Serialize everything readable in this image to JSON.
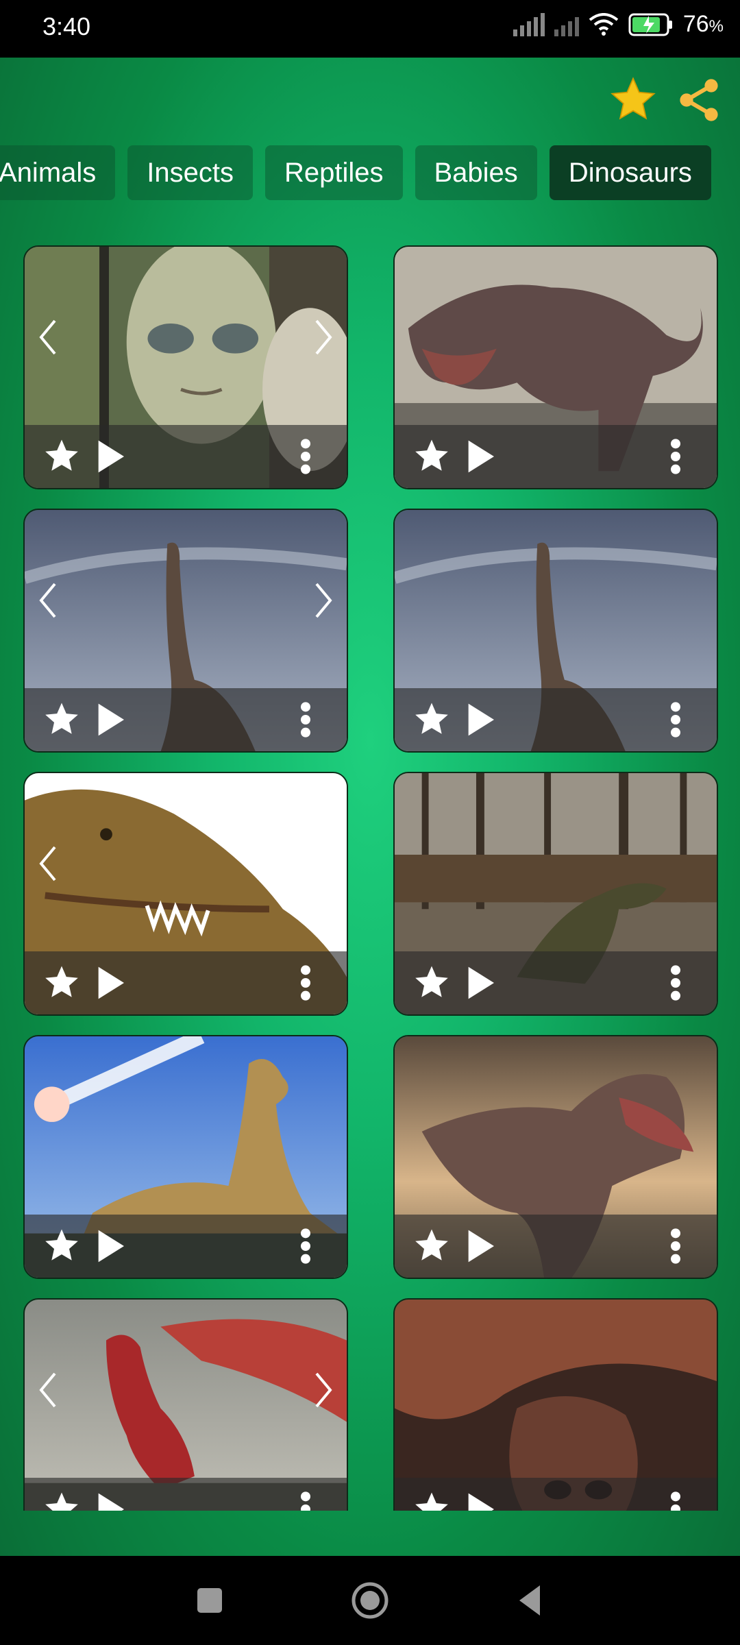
{
  "status": {
    "time": "3:40",
    "battery": "76",
    "battery_unit": "%"
  },
  "tabs": [
    {
      "label": "Animals",
      "active": false
    },
    {
      "label": "Insects",
      "active": false
    },
    {
      "label": "Reptiles",
      "active": false
    },
    {
      "label": "Babies",
      "active": false
    },
    {
      "label": "Dinosaurs",
      "active": true
    }
  ],
  "cards": [
    {
      "image": "alien",
      "arrows": true
    },
    {
      "image": "t-rex-roaring",
      "arrows": false
    },
    {
      "image": "brachiosaurus-sky",
      "arrows": true
    },
    {
      "image": "brachiosaurus-sky",
      "arrows": false
    },
    {
      "image": "dinosaur-head-closeup",
      "arrows": true
    },
    {
      "image": "raptor-forest",
      "arrows": false
    },
    {
      "image": "t-rex-meteor",
      "arrows": false
    },
    {
      "image": "t-rex-desert",
      "arrows": false
    },
    {
      "image": "red-dragon",
      "arrows": true
    },
    {
      "image": "dragon-closeup",
      "arrows": false
    }
  ],
  "icons": {
    "favorite": "star-icon",
    "share": "share-icon",
    "play": "play-icon",
    "more": "more-vertical-icon",
    "prev": "chevron-left-icon",
    "next": "chevron-right-icon"
  },
  "colors": {
    "accent_star": "#f5c518",
    "share": "#f5b942",
    "active_tab": "#0b3f24"
  }
}
